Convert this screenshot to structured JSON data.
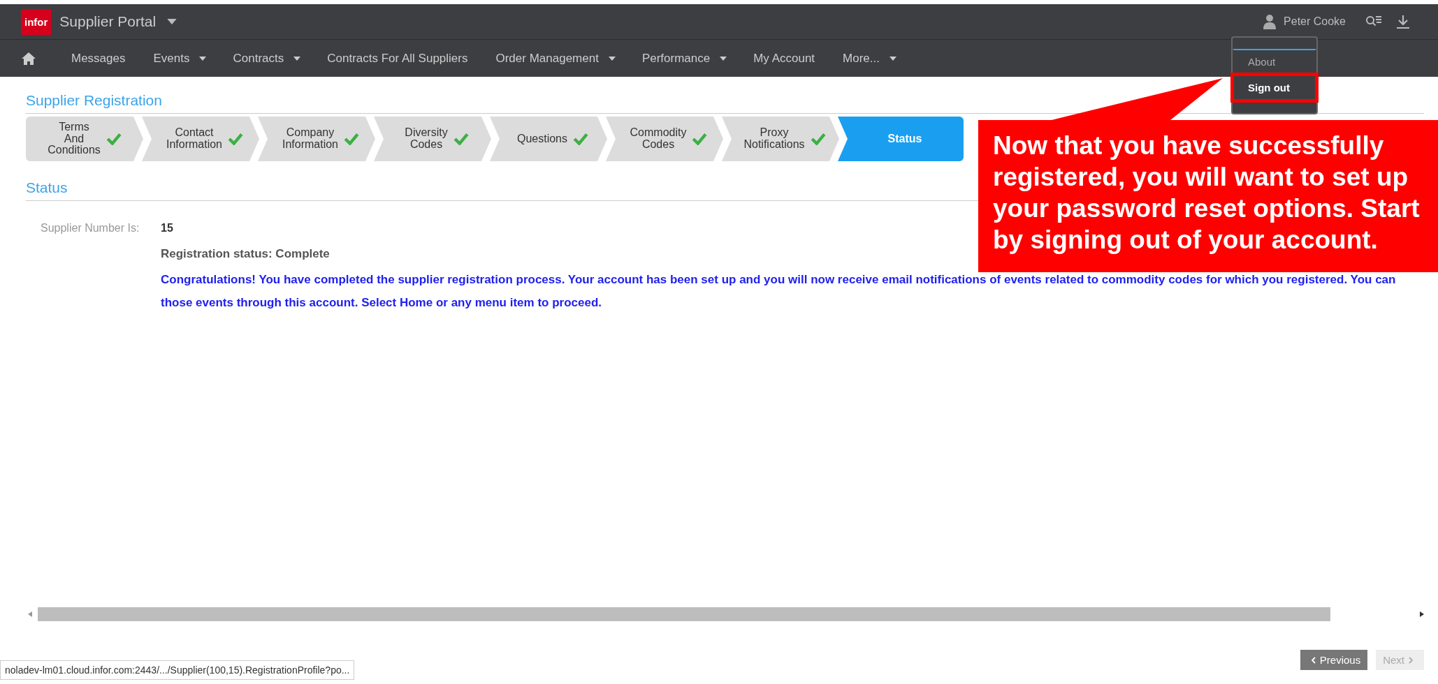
{
  "header": {
    "logo": "infor",
    "app_title": "Supplier Portal",
    "user_name": "Peter Cooke"
  },
  "nav": [
    {
      "label": "Messages",
      "has_menu": false
    },
    {
      "label": "Events",
      "has_menu": true
    },
    {
      "label": "Contracts",
      "has_menu": true
    },
    {
      "label": "Contracts For All Suppliers",
      "has_menu": false
    },
    {
      "label": "Order Management",
      "has_menu": true
    },
    {
      "label": "Performance",
      "has_menu": true
    },
    {
      "label": "My Account",
      "has_menu": false
    },
    {
      "label": "More...",
      "has_menu": true
    }
  ],
  "user_menu": [
    {
      "label": "About",
      "focused": true,
      "highlighted": false
    },
    {
      "label": "Sign out",
      "focused": false,
      "highlighted": true
    }
  ],
  "page_title": "Supplier Registration",
  "steps": [
    {
      "label": "Terms\nAnd\nConditions",
      "done": true,
      "selected": false
    },
    {
      "label": "Contact\nInformation",
      "done": true,
      "selected": false
    },
    {
      "label": "Company\nInformation",
      "done": true,
      "selected": false
    },
    {
      "label": "Diversity\nCodes",
      "done": true,
      "selected": false
    },
    {
      "label": "Questions",
      "done": true,
      "selected": false
    },
    {
      "label": "Commodity\nCodes",
      "done": true,
      "selected": false
    },
    {
      "label": "Proxy\nNotifications",
      "done": true,
      "selected": false
    },
    {
      "label": "Status",
      "done": false,
      "selected": true
    }
  ],
  "section_title": "Status",
  "supplier_number": {
    "label": "Supplier Number Is:",
    "value": "15"
  },
  "registration_status": "Registration status: Complete",
  "message_lines": [
    "Congratulations! You have completed the supplier registration process. Your account has been set up and you will now receive email notifications of events related to commodity codes for which you registered. You can",
    "those events through this account. Select Home or any menu item to proceed."
  ],
  "buttons": [
    {
      "label": "Previous",
      "disabled": false
    },
    {
      "label": "Next",
      "disabled": true
    }
  ],
  "status_url": "noladev-lm01.cloud.infor.com:2443/.../Supplier(100,15).RegistrationProfile?po...",
  "callout": "Now that you have successfully registered, you will want to set up your password reset options. Start by signing out of your account."
}
